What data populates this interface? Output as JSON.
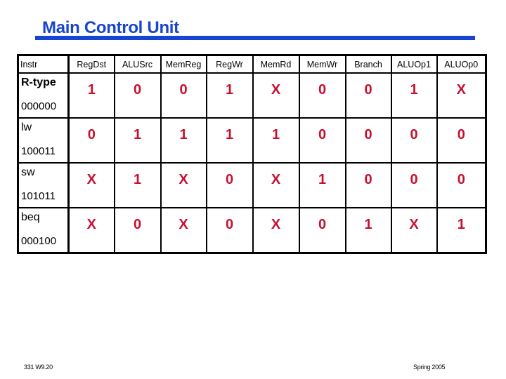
{
  "slide": {
    "title": "Main Control Unit",
    "colors": {
      "title": "#1744d0",
      "values": "#c8102e"
    }
  },
  "table": {
    "headers": [
      "Instr",
      "RegDst",
      "ALUSrc",
      "MemReg",
      "RegWr",
      "MemRd",
      "MemWr",
      "Branch",
      "ALUOp1",
      "ALUOp0"
    ],
    "rows": [
      {
        "instr": "R-type",
        "opcode": "000000",
        "values": [
          "1",
          "0",
          "0",
          "1",
          "X",
          "0",
          "0",
          "1",
          "X"
        ]
      },
      {
        "instr": "lw",
        "opcode": "100011",
        "values": [
          "0",
          "1",
          "1",
          "1",
          "1",
          "0",
          "0",
          "0",
          "0"
        ]
      },
      {
        "instr": "sw",
        "opcode": "101011",
        "values": [
          "X",
          "1",
          "X",
          "0",
          "X",
          "1",
          "0",
          "0",
          "0"
        ]
      },
      {
        "instr": "beq",
        "opcode": "000100",
        "values": [
          "X",
          "0",
          "X",
          "0",
          "X",
          "0",
          "1",
          "X",
          "1"
        ]
      }
    ]
  },
  "footer": {
    "left": "331  W9.20",
    "right": "Spring 2005"
  }
}
